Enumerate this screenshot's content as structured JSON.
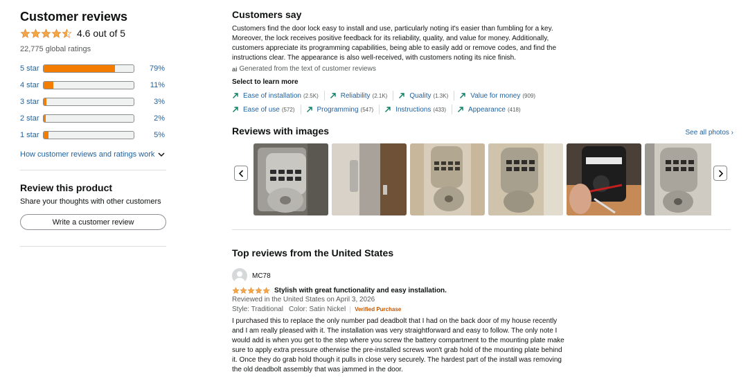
{
  "left": {
    "title": "Customer reviews",
    "average_rating": 4.6,
    "average_text": "4.6 out of 5",
    "global_ratings": "22,775 global ratings",
    "histogram": [
      {
        "label": "5 star",
        "percent_text": "79%",
        "percent": 79
      },
      {
        "label": "4 star",
        "percent_text": "11%",
        "percent": 11
      },
      {
        "label": "3 star",
        "percent_text": "3%",
        "percent": 3
      },
      {
        "label": "2 star",
        "percent_text": "2%",
        "percent": 2
      },
      {
        "label": "1 star",
        "percent_text": "5%",
        "percent": 5
      }
    ],
    "how_link": "How customer reviews and ratings work",
    "review_product_title": "Review this product",
    "share_text": "Share your thoughts with other customers",
    "write_button": "Write a customer review"
  },
  "customers_say": {
    "title": "Customers say",
    "summary": "Customers find the door lock easy to install and use, particularly noting it's easier than fumbling for a key. Moreover, the lock receives positive feedback for its reliability, quality, and value for money. Additionally, customers appreciate its programming capabilities, being able to easily add or remove codes, and find the instructions clear. The appearance is also well-received, with customers noting its nice finish.",
    "ai_badge": "ai",
    "ai_note": "Generated from the text of customer reviews",
    "learn_more": "Select to learn more",
    "aspects": [
      {
        "label": "Ease of installation",
        "count": "(2.5K)"
      },
      {
        "label": "Reliability",
        "count": "(2.1K)"
      },
      {
        "label": "Quality",
        "count": "(1.3K)"
      },
      {
        "label": "Value for money",
        "count": "(909)"
      },
      {
        "label": "Ease of use",
        "count": "(572)"
      },
      {
        "label": "Programming",
        "count": "(547)"
      },
      {
        "label": "Instructions",
        "count": "(433)"
      },
      {
        "label": "Appearance",
        "count": "(418)"
      }
    ]
  },
  "reviews_with_images": {
    "title": "Reviews with images",
    "see_all": "See all photos ›"
  },
  "top_reviews": {
    "title": "Top reviews from the United States",
    "review": {
      "reviewer": "MC78",
      "rating": 5,
      "title": "Stylish with great functionality and easy installation.",
      "date": "Reviewed in the United States on April 3, 2026",
      "style": "Style: Traditional",
      "color": "Color: Satin Nickel",
      "verified": "Verified Purchase",
      "body": "I purchased this to replace the only number pad deadbolt that I had on the back door of my house recently and I am really pleased with it. The installation was very straightforward and easy to follow. The only note I would add is when you get to the step where you screw the battery compartment to the mounting plate make sure to apply extra pressure otherwise the pre-installed screws won't grab hold of the mounting plate behind it. Once they do grab hold though it pulls in close very securely. The hardest part of the install was removing the old deadbolt assembly that was jammed in the door."
    }
  },
  "colors": {
    "accent_orange": "#f47c00",
    "star": "#f3a847",
    "link": "#2162a1",
    "verified": "#c45500",
    "aspect_arrow": "#067d62"
  }
}
